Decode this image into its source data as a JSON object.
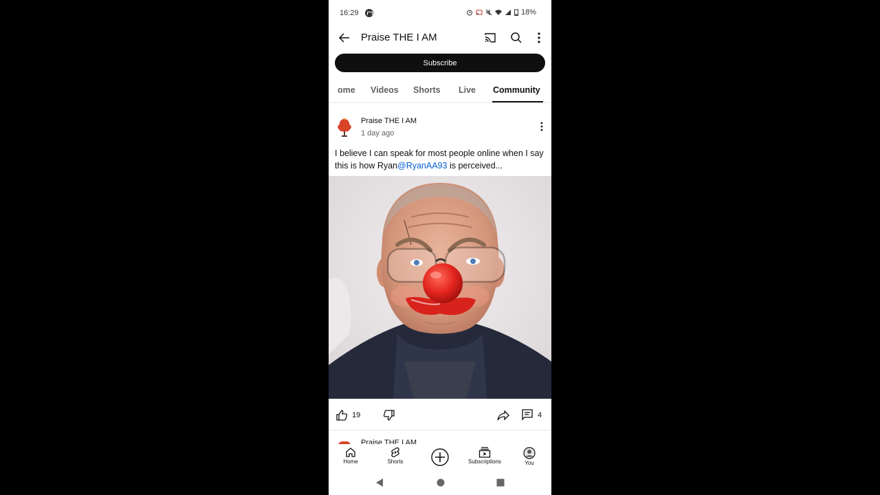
{
  "status_bar": {
    "time": "16:29",
    "battery": "18%"
  },
  "header": {
    "title": "Praise THE I AM",
    "back_icon": "arrow-left-icon",
    "cast_icon": "cast-icon",
    "search_icon": "search-icon",
    "more_icon": "more-vert-icon"
  },
  "subscribe_label": "Subscribe",
  "tabs": [
    {
      "label": "ome",
      "active": false
    },
    {
      "label": "Videos",
      "active": false
    },
    {
      "label": "Shorts",
      "active": false
    },
    {
      "label": "Live",
      "active": false
    },
    {
      "label": "Community",
      "active": true
    }
  ],
  "post": {
    "author": "Praise THE I AM",
    "time": "1 day ago",
    "text_before": "I believe I can speak for most people online when I say this is how Ryan",
    "mention": "@RyanAA93",
    "text_after": " is perceived...",
    "like_count": "19",
    "comment_count": "4"
  },
  "next_post": {
    "author": "Praise THE I AM"
  },
  "bottom_nav": [
    {
      "label": "Home",
      "icon": "home-icon"
    },
    {
      "label": "Shorts",
      "icon": "shorts-icon"
    },
    {
      "label": "",
      "icon": "create-plus-icon"
    },
    {
      "label": "Subscriptions",
      "icon": "subscriptions-icon"
    },
    {
      "label": "You",
      "icon": "avatar-icon"
    }
  ],
  "colors": {
    "link": "#065fd4",
    "subscribe_bg": "#0f0f0f",
    "text": "#0f0f0f",
    "secondary_text": "#606060"
  }
}
